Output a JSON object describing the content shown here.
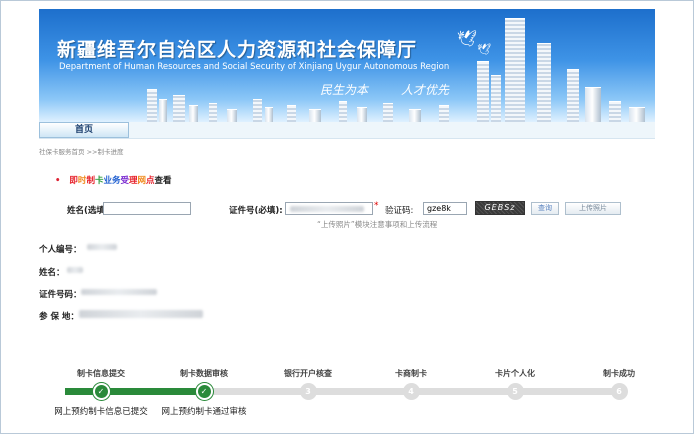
{
  "header": {
    "title": "新疆维吾尔自治区人力资源和社会保障厅",
    "subtitle": "Department of Human Resources and Social Security of Xinjiang Uygur Autonomous Region",
    "slogan_left": "民生为本",
    "slogan_right": "人才优先"
  },
  "nav": {
    "home_label": "首页"
  },
  "breadcrumb": "社保卡服务首页 >>制卡进度",
  "notice": {
    "segments": [
      {
        "text": "即",
        "color": "#e6202a"
      },
      {
        "text": "时",
        "color": "#f08a1c"
      },
      {
        "text": "制",
        "color": "#e6202a"
      },
      {
        "text": "卡",
        "color": "#2a9a3a"
      },
      {
        "text": "业务",
        "color": "#1f5fd0"
      },
      {
        "text": "受",
        "color": "#7a2ad0"
      },
      {
        "text": "理",
        "color": "#e6202a"
      },
      {
        "text": "网",
        "color": "#f08a1c"
      },
      {
        "text": "点",
        "color": "#e6202a"
      },
      {
        "text": "查看",
        "color": "#222222"
      }
    ]
  },
  "form": {
    "name_label": "姓名(选填):",
    "name_value": "",
    "id_label": "证件号(必填):",
    "captcha_label": "验证码:",
    "captcha_value": "gze8k",
    "captcha_image_text": "GEBSz",
    "query_button": "查询",
    "upload_button": "上传照片",
    "hint": "“上传照片”模块注意事项和上传流程"
  },
  "info": {
    "person_no_label": "个人编号：",
    "name_label": "姓名：",
    "id_label": "证件号码：",
    "location_label": "参 保 地："
  },
  "progress": {
    "completed": 2,
    "steps": [
      {
        "title": "制卡信息提交",
        "marker": "✓",
        "desc": "网上预约制卡信息已提交"
      },
      {
        "title": "制卡数据审核",
        "marker": "✓",
        "desc": "网上预约制卡通过审核"
      },
      {
        "title": "银行开户核查",
        "marker": "3",
        "desc": ""
      },
      {
        "title": "卡商制卡",
        "marker": "4",
        "desc": ""
      },
      {
        "title": "卡片个人化",
        "marker": "5",
        "desc": ""
      },
      {
        "title": "制卡成功",
        "marker": "6",
        "desc": ""
      }
    ]
  }
}
